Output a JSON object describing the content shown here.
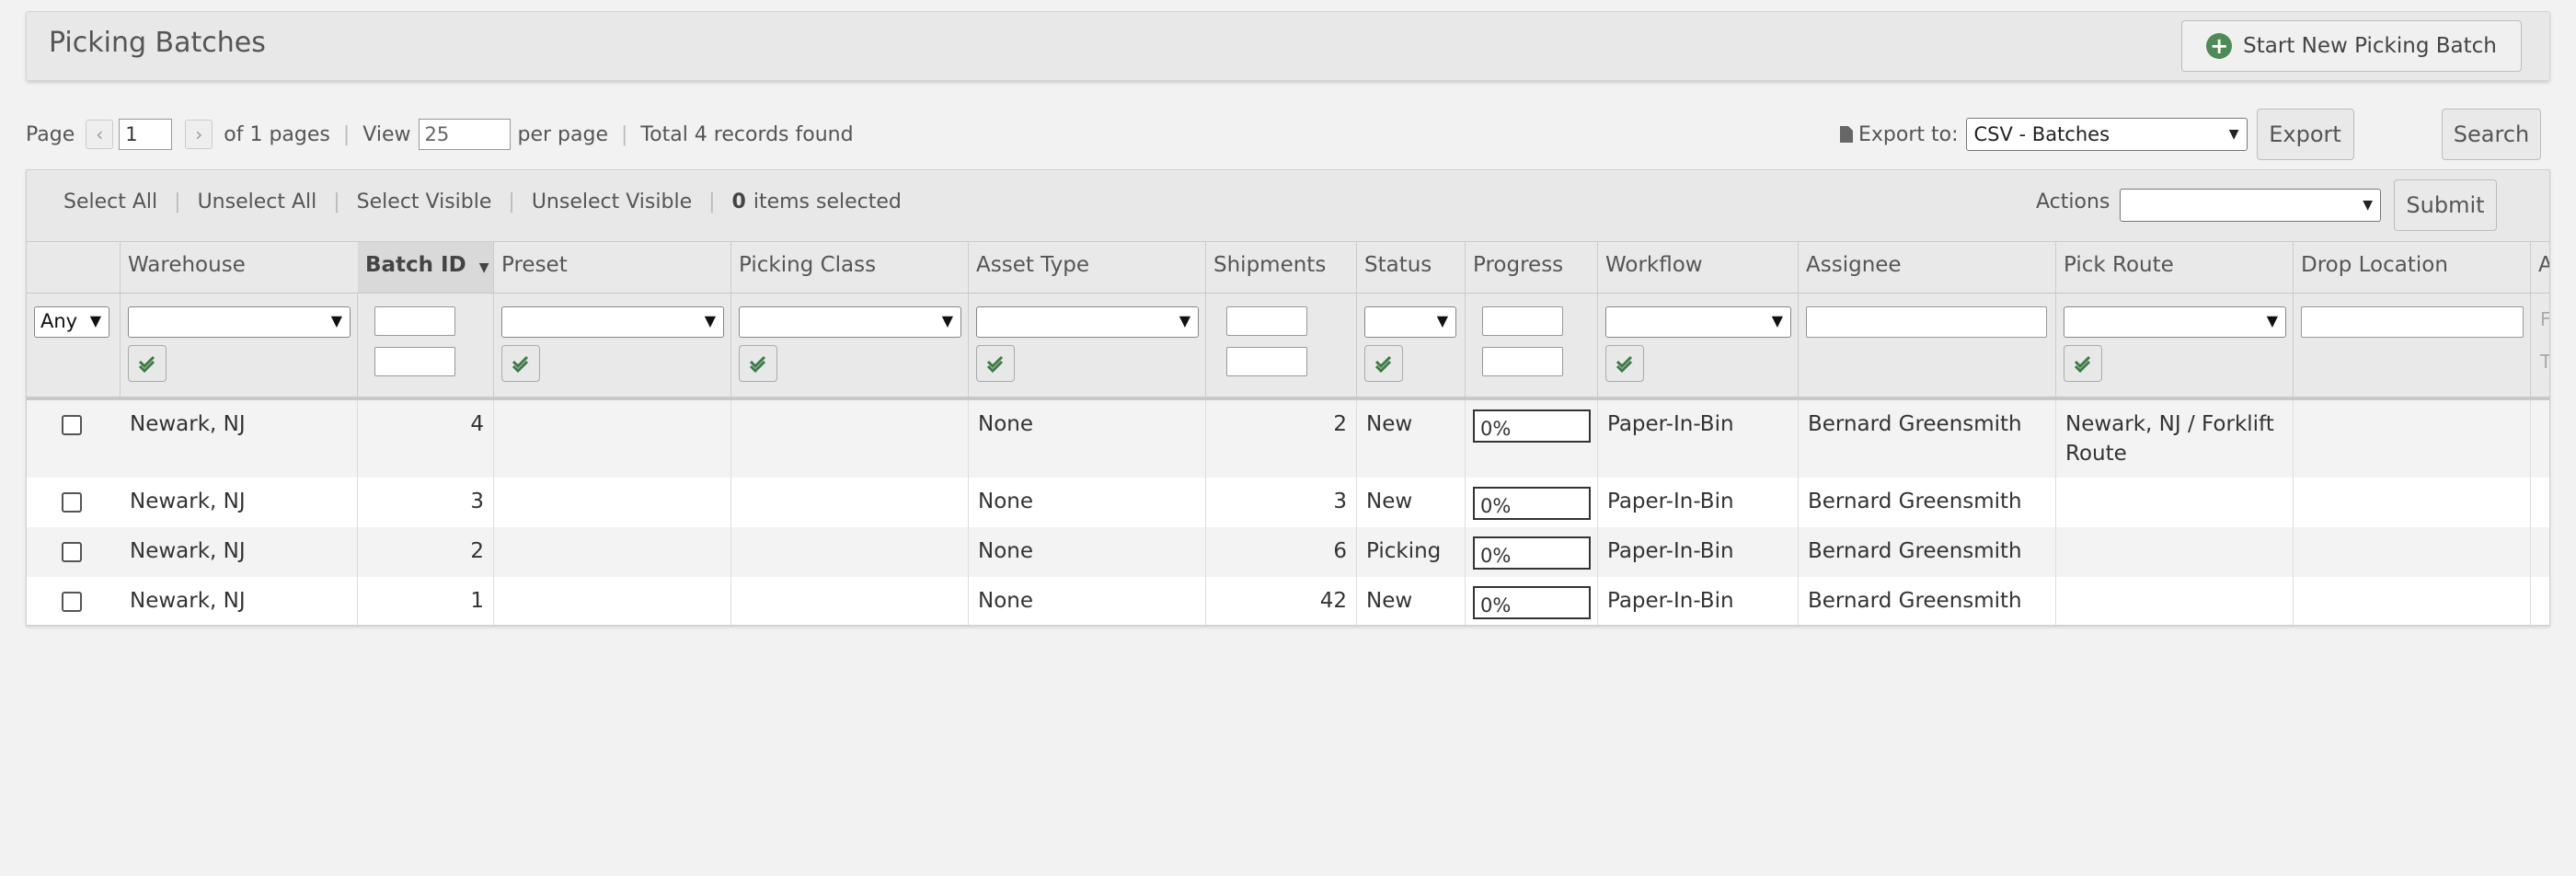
{
  "header": {
    "title": "Picking Batches",
    "start_button_label": "Start New Picking Batch"
  },
  "pager": {
    "page_label": "Page",
    "page_value": "1",
    "of_pages": "of 1 pages",
    "view_label": "View",
    "per_page_value": "25",
    "per_page_label": "per page",
    "total_records": "Total 4 records found"
  },
  "export": {
    "label": "Export to:",
    "selected": "CSV - Batches",
    "button_label": "Export"
  },
  "search_button_label": "Search",
  "selection_toolbar": {
    "select_all": "Select All",
    "unselect_all": "Unselect All",
    "select_visible": "Select Visible",
    "unselect_visible": "Unselect Visible",
    "selected_count": "0",
    "selected_suffix": "items selected",
    "actions_label": "Actions",
    "actions_selected": "",
    "submit_label": "Submit"
  },
  "columns": [
    "Warehouse",
    "Batch ID",
    "Preset",
    "Picking Class",
    "Asset Type",
    "Shipments",
    "Status",
    "Progress",
    "Workflow",
    "Assignee",
    "Pick Route",
    "Drop Location",
    "A"
  ],
  "filters": {
    "any_label": "Any",
    "partial_1": "F",
    "partial_2": "T"
  },
  "rows": [
    {
      "warehouse": "Newark, NJ",
      "batch_id": "4",
      "preset": "",
      "picking_class": "",
      "asset_type": "None",
      "shipments": "2",
      "status": "New",
      "progress": "0%",
      "workflow": "Paper-In-Bin",
      "assignee": "Bernard Greensmith",
      "pick_route": "Newark, NJ / Forklift",
      "pick_route_2": "Route",
      "drop_location": ""
    },
    {
      "warehouse": "Newark, NJ",
      "batch_id": "3",
      "preset": "",
      "picking_class": "",
      "asset_type": "None",
      "shipments": "3",
      "status": "New",
      "progress": "0%",
      "workflow": "Paper-In-Bin",
      "assignee": "Bernard Greensmith",
      "pick_route": "",
      "pick_route_2": "",
      "drop_location": ""
    },
    {
      "warehouse": "Newark, NJ",
      "batch_id": "2",
      "preset": "",
      "picking_class": "",
      "asset_type": "None",
      "shipments": "6",
      "status": "Picking",
      "progress": "0%",
      "workflow": "Paper-In-Bin",
      "assignee": "Bernard Greensmith",
      "pick_route": "",
      "pick_route_2": "",
      "drop_location": ""
    },
    {
      "warehouse": "Newark, NJ",
      "batch_id": "1",
      "preset": "",
      "picking_class": "",
      "asset_type": "None",
      "shipments": "42",
      "status": "New",
      "progress": "0%",
      "workflow": "Paper-In-Bin",
      "assignee": "Bernard Greensmith",
      "pick_route": "",
      "pick_route_2": "",
      "drop_location": ""
    }
  ]
}
